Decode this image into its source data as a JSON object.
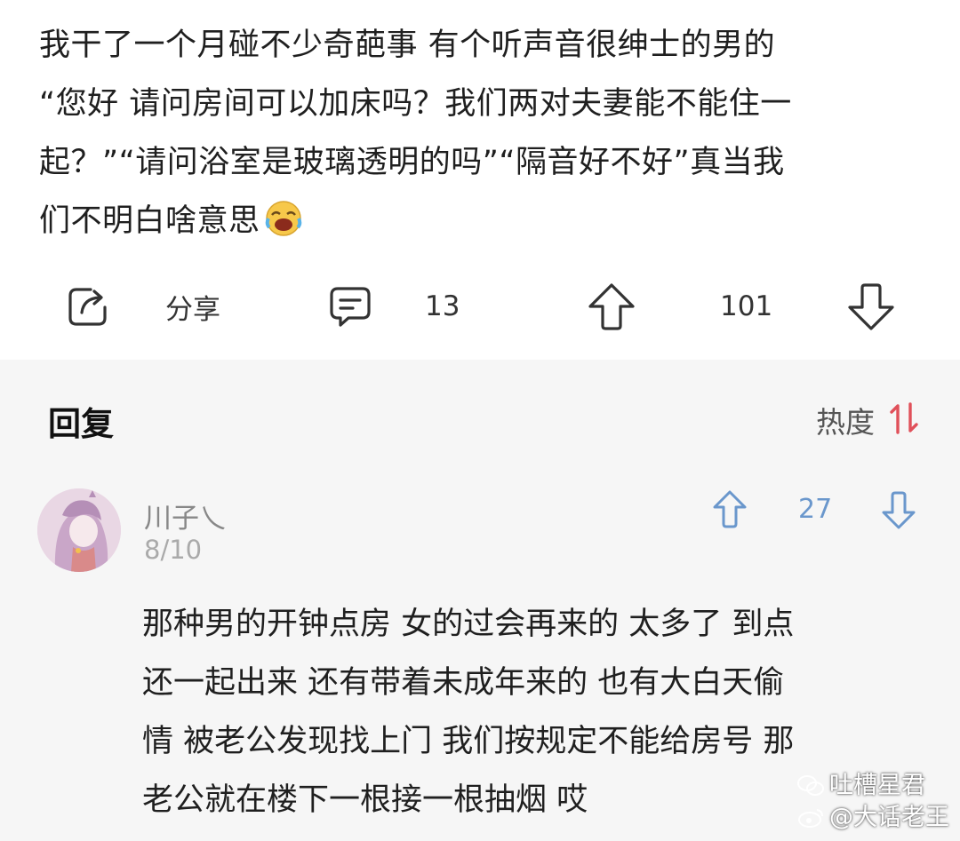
{
  "post": {
    "lines": [
      "我干了一个月碰不少奇葩事 有个听声音很绅士的男的",
      "“您好 请问房间可以加床吗？我们两对夫妻能不能住一",
      "起？”“请问浴室是玻璃透明的吗”“隔音好不好”真当我",
      "们不明白啥意思"
    ],
    "emoji": "laughing-crying-emoji"
  },
  "actions": {
    "share_label": "分享",
    "comment_count": "13",
    "upvote_count": "101"
  },
  "replies": {
    "title": "回复",
    "sort_label": "热度",
    "comment": {
      "username": "川子乀",
      "date": "8/10",
      "vote_count": "27",
      "lines": [
        "那种男的开钟点房 女的过会再来的 太多了 到点",
        "还一起出来 还有带着未成年来的 也有大白天偷",
        "情 被老公发现找上门 我们按规定不能给房号 那",
        "老公就在楼下一根接一根抽烟 哎"
      ]
    }
  },
  "watermark": {
    "line1": "吐槽星君",
    "line2": "@大话老王"
  },
  "colors": {
    "accent_red": "#e0505a",
    "vote_blue": "#6a97cc",
    "reply_bg": "#f6f6f6"
  }
}
